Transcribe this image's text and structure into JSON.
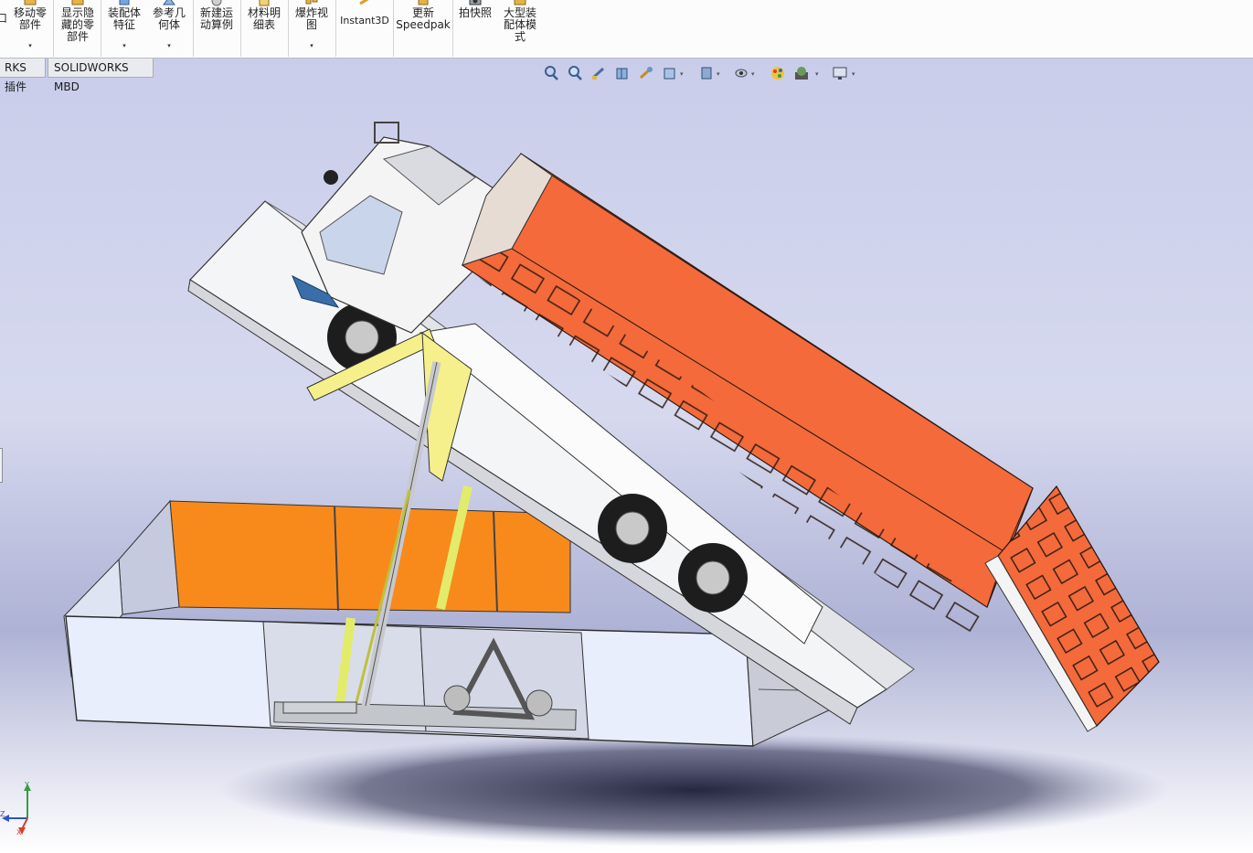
{
  "ribbon": {
    "tools": [
      {
        "id": "move-component",
        "label": "移动零\n部件",
        "dropdown": "▾"
      },
      {
        "id": "show-hidden",
        "label": "显示隐\n藏的零\n部件",
        "dropdown": ""
      },
      {
        "id": "assembly-features",
        "label": "装配体\n特征",
        "dropdown": "▾"
      },
      {
        "id": "reference-geometry",
        "label": "参考几\n何体",
        "dropdown": "▾"
      },
      {
        "id": "new-motion-study",
        "label": "新建运\n动算例",
        "dropdown": ""
      },
      {
        "id": "bill-of-materials",
        "label": "材料明\n细表",
        "dropdown": ""
      },
      {
        "id": "exploded-view",
        "label": "爆炸视\n图",
        "dropdown": "▾"
      },
      {
        "id": "instant3d",
        "label": "Instant3D",
        "dropdown": ""
      },
      {
        "id": "update-speedpak",
        "label": "更新\nSpeedpak",
        "dropdown": ""
      },
      {
        "id": "take-snapshot",
        "label": "拍快照",
        "dropdown": ""
      },
      {
        "id": "large-assembly-mode",
        "label": "大型装\n配体模\n式",
        "dropdown": ""
      }
    ],
    "left_cut_label": "口"
  },
  "tabs": [
    {
      "label": "RKS 插件"
    },
    {
      "label": "SOLIDWORKS MBD"
    }
  ],
  "view_toolbar": {
    "icons": [
      "zoom-to-fit-icon",
      "zoom-to-area-icon",
      "previous-view-icon",
      "section-view-icon",
      "dynamic-annotation-icon",
      "view-orientation-icon",
      "display-style-icon",
      "hide-show-items-icon",
      "edit-appearance-icon",
      "apply-scene-icon",
      "view-settings-icon"
    ],
    "dropdown_glyph": "▾"
  },
  "triad": {
    "x_label": "X",
    "y_label": "Y",
    "z_label": "Z"
  },
  "colors": {
    "background_top": "#d4d8ef",
    "background_mid": "#a7acd2",
    "background_bottom": "#ffffff",
    "truck_body": "#f46a3a",
    "platform_orange": "#f88a1c",
    "platform_panel": "#e6ecf8",
    "hydraulic_yellow": "#f5f08c",
    "frame_gray": "#c9ccd1"
  }
}
